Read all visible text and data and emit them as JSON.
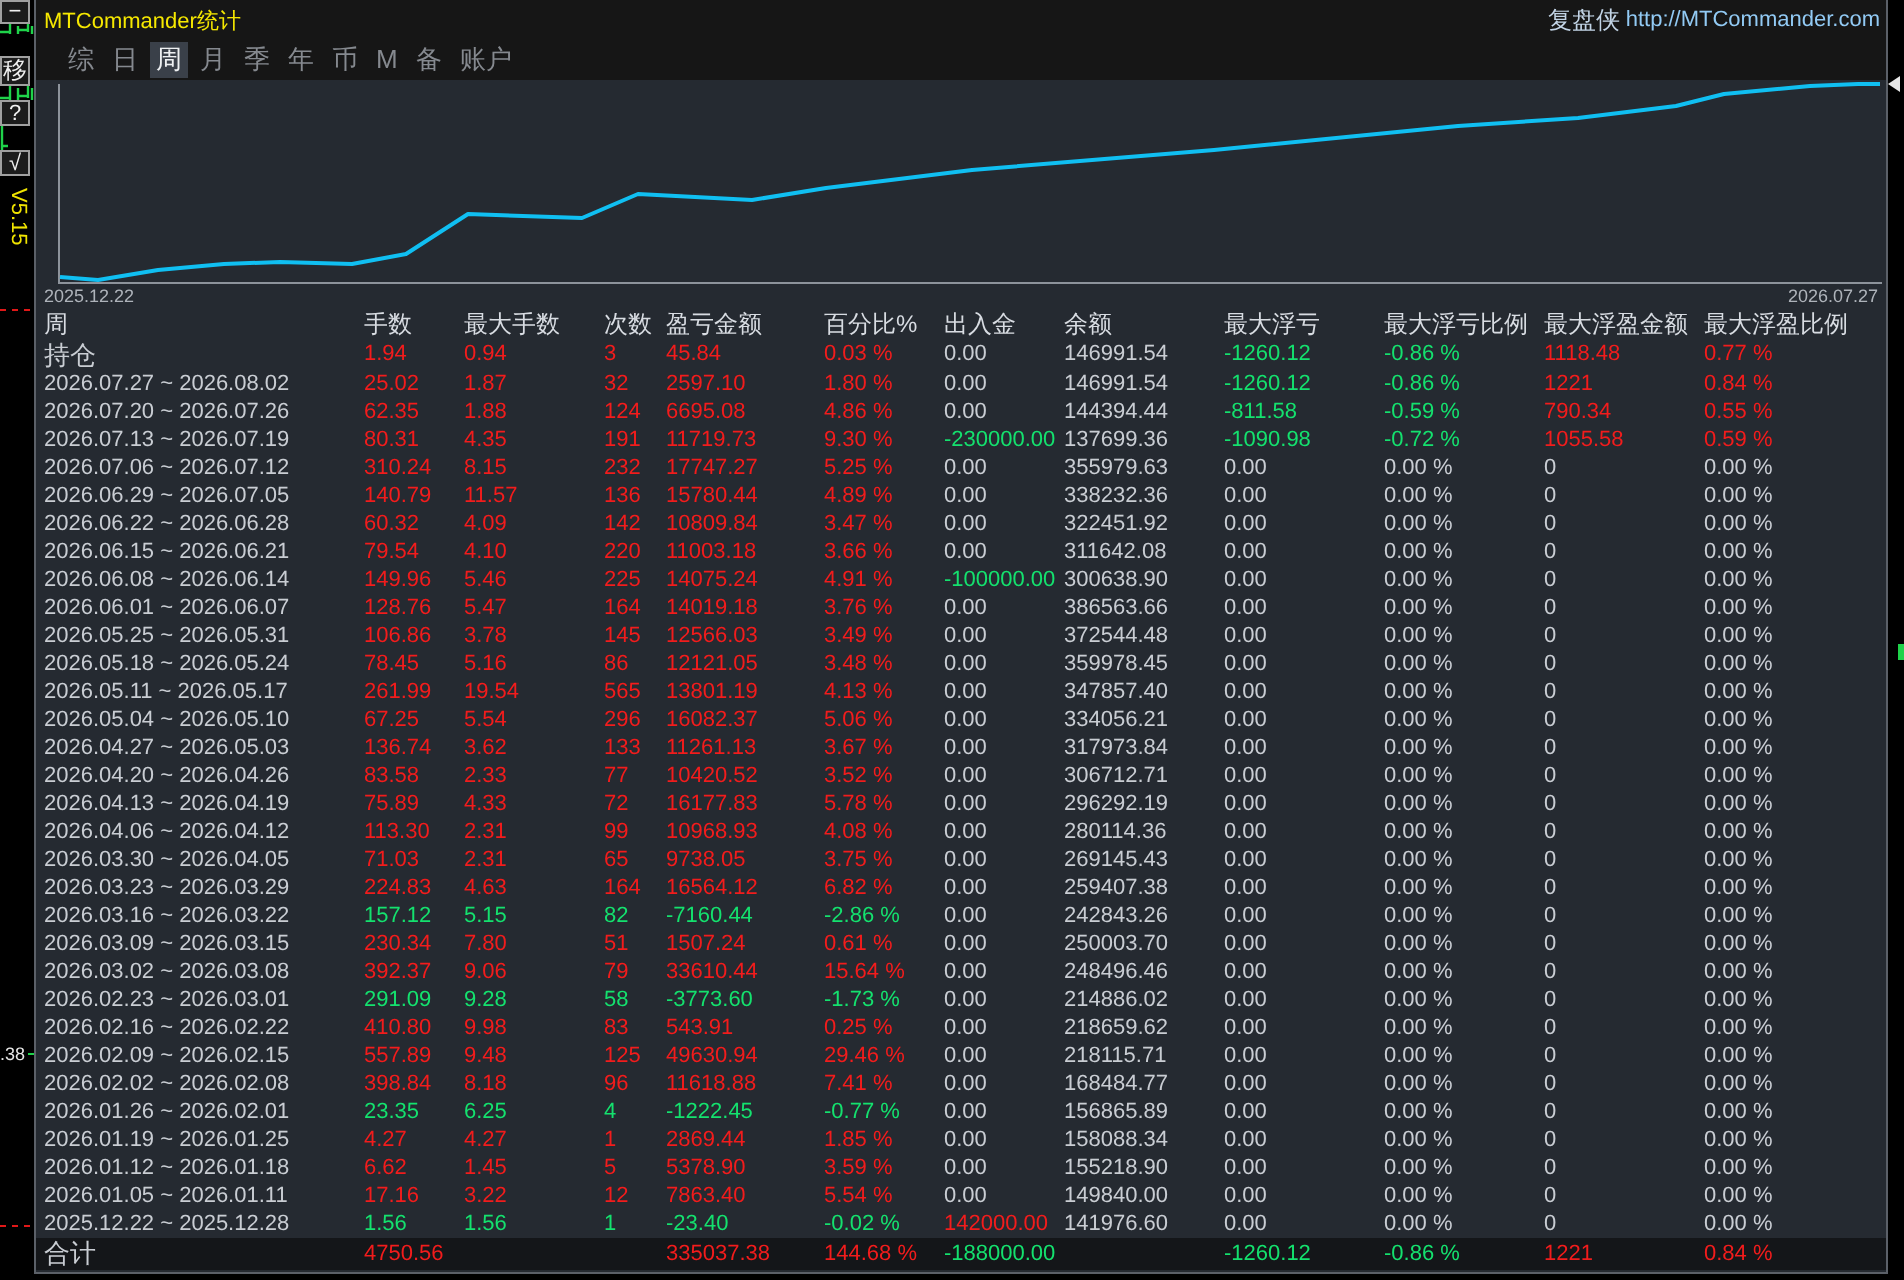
{
  "left_toolbar": {
    "buttons": [
      "−",
      "移",
      "?",
      "√"
    ],
    "version": "V5.15",
    "price_label": ".38"
  },
  "window": {
    "title": "MTCommander统计",
    "brand": "复盘侠",
    "url": "http://MTCommander.com"
  },
  "tabs": [
    {
      "label": "综",
      "selected": false
    },
    {
      "label": "日",
      "selected": false
    },
    {
      "label": "周",
      "selected": true
    },
    {
      "label": "月",
      "selected": false
    },
    {
      "label": "季",
      "selected": false
    },
    {
      "label": "年",
      "selected": false
    },
    {
      "label": "币",
      "selected": false
    },
    {
      "label": "M",
      "selected": false
    },
    {
      "label": "备",
      "selected": false
    },
    {
      "label": "账户",
      "selected": false
    }
  ],
  "chart": {
    "start_label": "2025.12.22",
    "end_label": "2026.07.27"
  },
  "table": {
    "columns": [
      "周",
      "手数",
      "最大手数",
      "次数",
      "盈亏金额",
      "百分比%",
      "出入金",
      "余额",
      "最大浮亏",
      "最大浮亏比例",
      "最大浮盈金额",
      "最大浮盈比例"
    ],
    "rows": [
      {
        "kind": "open",
        "cells": [
          {
            "text": "持仓"
          },
          {
            "text": "1.94",
            "color": "#f21c1c"
          },
          {
            "text": "0.94",
            "color": "#f21c1c"
          },
          {
            "text": "3",
            "color": "#f21c1c"
          },
          {
            "text": "45.84",
            "color": "#f21c1c"
          },
          {
            "text": "0.03 %",
            "color": "#f21c1c"
          },
          {
            "text": "0.00"
          },
          {
            "text": "146991.54"
          },
          {
            "text": "-1260.12",
            "color": "#14e16e"
          },
          {
            "text": "-0.86 %",
            "color": "#14e16e"
          },
          {
            "text": "1118.48",
            "color": "#f21c1c"
          },
          {
            "text": "0.77 %",
            "color": "#f21c1c"
          }
        ]
      },
      {
        "kind": "week",
        "cells": [
          {
            "text": "2026.07.27 ~ 2026.08.02"
          },
          {
            "text": "25.02",
            "color": "#f21c1c"
          },
          {
            "text": "1.87",
            "color": "#f21c1c"
          },
          {
            "text": "32",
            "color": "#f21c1c"
          },
          {
            "text": "2597.10",
            "color": "#f21c1c"
          },
          {
            "text": "1.80 %",
            "color": "#f21c1c"
          },
          {
            "text": "0.00"
          },
          {
            "text": "146991.54"
          },
          {
            "text": "-1260.12",
            "color": "#14e16e"
          },
          {
            "text": "-0.86 %",
            "color": "#14e16e"
          },
          {
            "text": "1221",
            "color": "#f21c1c"
          },
          {
            "text": "0.84 %",
            "color": "#f21c1c"
          }
        ]
      },
      {
        "kind": "week",
        "cells": [
          {
            "text": "2026.07.20 ~ 2026.07.26"
          },
          {
            "text": "62.35",
            "color": "#f21c1c"
          },
          {
            "text": "1.88",
            "color": "#f21c1c"
          },
          {
            "text": "124",
            "color": "#f21c1c"
          },
          {
            "text": "6695.08",
            "color": "#f21c1c"
          },
          {
            "text": "4.86 %",
            "color": "#f21c1c"
          },
          {
            "text": "0.00"
          },
          {
            "text": "144394.44"
          },
          {
            "text": "-811.58",
            "color": "#14e16e"
          },
          {
            "text": "-0.59 %",
            "color": "#14e16e"
          },
          {
            "text": "790.34",
            "color": "#f21c1c"
          },
          {
            "text": "0.55 %",
            "color": "#f21c1c"
          }
        ]
      },
      {
        "kind": "week",
        "cells": [
          {
            "text": "2026.07.13 ~ 2026.07.19"
          },
          {
            "text": "80.31",
            "color": "#f21c1c"
          },
          {
            "text": "4.35",
            "color": "#f21c1c"
          },
          {
            "text": "191",
            "color": "#f21c1c"
          },
          {
            "text": "11719.73",
            "color": "#f21c1c"
          },
          {
            "text": "9.30 %",
            "color": "#f21c1c"
          },
          {
            "text": "-230000.00",
            "color": "#14e16e"
          },
          {
            "text": "137699.36"
          },
          {
            "text": "-1090.98",
            "color": "#14e16e"
          },
          {
            "text": "-0.72 %",
            "color": "#14e16e"
          },
          {
            "text": "1055.58",
            "color": "#f21c1c"
          },
          {
            "text": "0.59 %",
            "color": "#f21c1c"
          }
        ]
      },
      {
        "kind": "week",
        "cells": [
          {
            "text": "2026.07.06 ~ 2026.07.12"
          },
          {
            "text": "310.24",
            "color": "#f21c1c"
          },
          {
            "text": "8.15",
            "color": "#f21c1c"
          },
          {
            "text": "232",
            "color": "#f21c1c"
          },
          {
            "text": "17747.27",
            "color": "#f21c1c"
          },
          {
            "text": "5.25 %",
            "color": "#f21c1c"
          },
          {
            "text": "0.00"
          },
          {
            "text": "355979.63"
          },
          {
            "text": "0.00"
          },
          {
            "text": "0.00 %"
          },
          {
            "text": "0"
          },
          {
            "text": "0.00 %"
          }
        ]
      },
      {
        "kind": "week",
        "cells": [
          {
            "text": "2026.06.29 ~ 2026.07.05"
          },
          {
            "text": "140.79",
            "color": "#f21c1c"
          },
          {
            "text": "11.57",
            "color": "#f21c1c"
          },
          {
            "text": "136",
            "color": "#f21c1c"
          },
          {
            "text": "15780.44",
            "color": "#f21c1c"
          },
          {
            "text": "4.89 %",
            "color": "#f21c1c"
          },
          {
            "text": "0.00"
          },
          {
            "text": "338232.36"
          },
          {
            "text": "0.00"
          },
          {
            "text": "0.00 %"
          },
          {
            "text": "0"
          },
          {
            "text": "0.00 %"
          }
        ]
      },
      {
        "kind": "week",
        "cells": [
          {
            "text": "2026.06.22 ~ 2026.06.28"
          },
          {
            "text": "60.32",
            "color": "#f21c1c"
          },
          {
            "text": "4.09",
            "color": "#f21c1c"
          },
          {
            "text": "142",
            "color": "#f21c1c"
          },
          {
            "text": "10809.84",
            "color": "#f21c1c"
          },
          {
            "text": "3.47 %",
            "color": "#f21c1c"
          },
          {
            "text": "0.00"
          },
          {
            "text": "322451.92"
          },
          {
            "text": "0.00"
          },
          {
            "text": "0.00 %"
          },
          {
            "text": "0"
          },
          {
            "text": "0.00 %"
          }
        ]
      },
      {
        "kind": "week",
        "cells": [
          {
            "text": "2026.06.15 ~ 2026.06.21"
          },
          {
            "text": "79.54",
            "color": "#f21c1c"
          },
          {
            "text": "4.10",
            "color": "#f21c1c"
          },
          {
            "text": "220",
            "color": "#f21c1c"
          },
          {
            "text": "11003.18",
            "color": "#f21c1c"
          },
          {
            "text": "3.66 %",
            "color": "#f21c1c"
          },
          {
            "text": "0.00"
          },
          {
            "text": "311642.08"
          },
          {
            "text": "0.00"
          },
          {
            "text": "0.00 %"
          },
          {
            "text": "0"
          },
          {
            "text": "0.00 %"
          }
        ]
      },
      {
        "kind": "week",
        "cells": [
          {
            "text": "2026.06.08 ~ 2026.06.14"
          },
          {
            "text": "149.96",
            "color": "#f21c1c"
          },
          {
            "text": "5.46",
            "color": "#f21c1c"
          },
          {
            "text": "225",
            "color": "#f21c1c"
          },
          {
            "text": "14075.24",
            "color": "#f21c1c"
          },
          {
            "text": "4.91 %",
            "color": "#f21c1c"
          },
          {
            "text": "-100000.00",
            "color": "#14e16e"
          },
          {
            "text": "300638.90"
          },
          {
            "text": "0.00"
          },
          {
            "text": "0.00 %"
          },
          {
            "text": "0"
          },
          {
            "text": "0.00 %"
          }
        ]
      },
      {
        "kind": "week",
        "cells": [
          {
            "text": "2026.06.01 ~ 2026.06.07"
          },
          {
            "text": "128.76",
            "color": "#f21c1c"
          },
          {
            "text": "5.47",
            "color": "#f21c1c"
          },
          {
            "text": "164",
            "color": "#f21c1c"
          },
          {
            "text": "14019.18",
            "color": "#f21c1c"
          },
          {
            "text": "3.76 %",
            "color": "#f21c1c"
          },
          {
            "text": "0.00"
          },
          {
            "text": "386563.66"
          },
          {
            "text": "0.00"
          },
          {
            "text": "0.00 %"
          },
          {
            "text": "0"
          },
          {
            "text": "0.00 %"
          }
        ]
      },
      {
        "kind": "week",
        "cells": [
          {
            "text": "2026.05.25 ~ 2026.05.31"
          },
          {
            "text": "106.86",
            "color": "#f21c1c"
          },
          {
            "text": "3.78",
            "color": "#f21c1c"
          },
          {
            "text": "145",
            "color": "#f21c1c"
          },
          {
            "text": "12566.03",
            "color": "#f21c1c"
          },
          {
            "text": "3.49 %",
            "color": "#f21c1c"
          },
          {
            "text": "0.00"
          },
          {
            "text": "372544.48"
          },
          {
            "text": "0.00"
          },
          {
            "text": "0.00 %"
          },
          {
            "text": "0"
          },
          {
            "text": "0.00 %"
          }
        ]
      },
      {
        "kind": "week",
        "cells": [
          {
            "text": "2026.05.18 ~ 2026.05.24"
          },
          {
            "text": "78.45",
            "color": "#f21c1c"
          },
          {
            "text": "5.16",
            "color": "#f21c1c"
          },
          {
            "text": "86",
            "color": "#f21c1c"
          },
          {
            "text": "12121.05",
            "color": "#f21c1c"
          },
          {
            "text": "3.48 %",
            "color": "#f21c1c"
          },
          {
            "text": "0.00"
          },
          {
            "text": "359978.45"
          },
          {
            "text": "0.00"
          },
          {
            "text": "0.00 %"
          },
          {
            "text": "0"
          },
          {
            "text": "0.00 %"
          }
        ]
      },
      {
        "kind": "week",
        "cells": [
          {
            "text": "2026.05.11 ~ 2026.05.17"
          },
          {
            "text": "261.99",
            "color": "#f21c1c"
          },
          {
            "text": "19.54",
            "color": "#f21c1c"
          },
          {
            "text": "565",
            "color": "#f21c1c"
          },
          {
            "text": "13801.19",
            "color": "#f21c1c"
          },
          {
            "text": "4.13 %",
            "color": "#f21c1c"
          },
          {
            "text": "0.00"
          },
          {
            "text": "347857.40"
          },
          {
            "text": "0.00"
          },
          {
            "text": "0.00 %"
          },
          {
            "text": "0"
          },
          {
            "text": "0.00 %"
          }
        ]
      },
      {
        "kind": "week",
        "cells": [
          {
            "text": "2026.05.04 ~ 2026.05.10"
          },
          {
            "text": "67.25",
            "color": "#f21c1c"
          },
          {
            "text": "5.54",
            "color": "#f21c1c"
          },
          {
            "text": "296",
            "color": "#f21c1c"
          },
          {
            "text": "16082.37",
            "color": "#f21c1c"
          },
          {
            "text": "5.06 %",
            "color": "#f21c1c"
          },
          {
            "text": "0.00"
          },
          {
            "text": "334056.21"
          },
          {
            "text": "0.00"
          },
          {
            "text": "0.00 %"
          },
          {
            "text": "0"
          },
          {
            "text": "0.00 %"
          }
        ]
      },
      {
        "kind": "week",
        "cells": [
          {
            "text": "2026.04.27 ~ 2026.05.03"
          },
          {
            "text": "136.74",
            "color": "#f21c1c"
          },
          {
            "text": "3.62",
            "color": "#f21c1c"
          },
          {
            "text": "133",
            "color": "#f21c1c"
          },
          {
            "text": "11261.13",
            "color": "#f21c1c"
          },
          {
            "text": "3.67 %",
            "color": "#f21c1c"
          },
          {
            "text": "0.00"
          },
          {
            "text": "317973.84"
          },
          {
            "text": "0.00"
          },
          {
            "text": "0.00 %"
          },
          {
            "text": "0"
          },
          {
            "text": "0.00 %"
          }
        ]
      },
      {
        "kind": "week",
        "cells": [
          {
            "text": "2026.04.20 ~ 2026.04.26"
          },
          {
            "text": "83.58",
            "color": "#f21c1c"
          },
          {
            "text": "2.33",
            "color": "#f21c1c"
          },
          {
            "text": "77",
            "color": "#f21c1c"
          },
          {
            "text": "10420.52",
            "color": "#f21c1c"
          },
          {
            "text": "3.52 %",
            "color": "#f21c1c"
          },
          {
            "text": "0.00"
          },
          {
            "text": "306712.71"
          },
          {
            "text": "0.00"
          },
          {
            "text": "0.00 %"
          },
          {
            "text": "0"
          },
          {
            "text": "0.00 %"
          }
        ]
      },
      {
        "kind": "week",
        "cells": [
          {
            "text": "2026.04.13 ~ 2026.04.19"
          },
          {
            "text": "75.89",
            "color": "#f21c1c"
          },
          {
            "text": "4.33",
            "color": "#f21c1c"
          },
          {
            "text": "72",
            "color": "#f21c1c"
          },
          {
            "text": "16177.83",
            "color": "#f21c1c"
          },
          {
            "text": "5.78 %",
            "color": "#f21c1c"
          },
          {
            "text": "0.00"
          },
          {
            "text": "296292.19"
          },
          {
            "text": "0.00"
          },
          {
            "text": "0.00 %"
          },
          {
            "text": "0"
          },
          {
            "text": "0.00 %"
          }
        ]
      },
      {
        "kind": "week",
        "cells": [
          {
            "text": "2026.04.06 ~ 2026.04.12"
          },
          {
            "text": "113.30",
            "color": "#f21c1c"
          },
          {
            "text": "2.31",
            "color": "#f21c1c"
          },
          {
            "text": "99",
            "color": "#f21c1c"
          },
          {
            "text": "10968.93",
            "color": "#f21c1c"
          },
          {
            "text": "4.08 %",
            "color": "#f21c1c"
          },
          {
            "text": "0.00"
          },
          {
            "text": "280114.36"
          },
          {
            "text": "0.00"
          },
          {
            "text": "0.00 %"
          },
          {
            "text": "0"
          },
          {
            "text": "0.00 %"
          }
        ]
      },
      {
        "kind": "week",
        "cells": [
          {
            "text": "2026.03.30 ~ 2026.04.05"
          },
          {
            "text": "71.03",
            "color": "#f21c1c"
          },
          {
            "text": "2.31",
            "color": "#f21c1c"
          },
          {
            "text": "65",
            "color": "#f21c1c"
          },
          {
            "text": "9738.05",
            "color": "#f21c1c"
          },
          {
            "text": "3.75 %",
            "color": "#f21c1c"
          },
          {
            "text": "0.00"
          },
          {
            "text": "269145.43"
          },
          {
            "text": "0.00"
          },
          {
            "text": "0.00 %"
          },
          {
            "text": "0"
          },
          {
            "text": "0.00 %"
          }
        ]
      },
      {
        "kind": "week",
        "cells": [
          {
            "text": "2026.03.23 ~ 2026.03.29"
          },
          {
            "text": "224.83",
            "color": "#f21c1c"
          },
          {
            "text": "4.63",
            "color": "#f21c1c"
          },
          {
            "text": "164",
            "color": "#f21c1c"
          },
          {
            "text": "16564.12",
            "color": "#f21c1c"
          },
          {
            "text": "6.82 %",
            "color": "#f21c1c"
          },
          {
            "text": "0.00"
          },
          {
            "text": "259407.38"
          },
          {
            "text": "0.00"
          },
          {
            "text": "0.00 %"
          },
          {
            "text": "0"
          },
          {
            "text": "0.00 %"
          }
        ]
      },
      {
        "kind": "week",
        "cells": [
          {
            "text": "2026.03.16 ~ 2026.03.22"
          },
          {
            "text": "157.12",
            "color": "#14e16e"
          },
          {
            "text": "5.15",
            "color": "#14e16e"
          },
          {
            "text": "82",
            "color": "#14e16e"
          },
          {
            "text": "-7160.44",
            "color": "#14e16e"
          },
          {
            "text": "-2.86 %",
            "color": "#14e16e"
          },
          {
            "text": "0.00"
          },
          {
            "text": "242843.26"
          },
          {
            "text": "0.00"
          },
          {
            "text": "0.00 %"
          },
          {
            "text": "0"
          },
          {
            "text": "0.00 %"
          }
        ]
      },
      {
        "kind": "week",
        "cells": [
          {
            "text": "2026.03.09 ~ 2026.03.15"
          },
          {
            "text": "230.34",
            "color": "#f21c1c"
          },
          {
            "text": "7.80",
            "color": "#f21c1c"
          },
          {
            "text": "51",
            "color": "#f21c1c"
          },
          {
            "text": "1507.24",
            "color": "#f21c1c"
          },
          {
            "text": "0.61 %",
            "color": "#f21c1c"
          },
          {
            "text": "0.00"
          },
          {
            "text": "250003.70"
          },
          {
            "text": "0.00"
          },
          {
            "text": "0.00 %"
          },
          {
            "text": "0"
          },
          {
            "text": "0.00 %"
          }
        ]
      },
      {
        "kind": "week",
        "cells": [
          {
            "text": "2026.03.02 ~ 2026.03.08"
          },
          {
            "text": "392.37",
            "color": "#f21c1c"
          },
          {
            "text": "9.06",
            "color": "#f21c1c"
          },
          {
            "text": "79",
            "color": "#f21c1c"
          },
          {
            "text": "33610.44",
            "color": "#f21c1c"
          },
          {
            "text": "15.64 %",
            "color": "#f21c1c"
          },
          {
            "text": "0.00"
          },
          {
            "text": "248496.46"
          },
          {
            "text": "0.00"
          },
          {
            "text": "0.00 %"
          },
          {
            "text": "0"
          },
          {
            "text": "0.00 %"
          }
        ]
      },
      {
        "kind": "week",
        "cells": [
          {
            "text": "2026.02.23 ~ 2026.03.01"
          },
          {
            "text": "291.09",
            "color": "#14e16e"
          },
          {
            "text": "9.28",
            "color": "#14e16e"
          },
          {
            "text": "58",
            "color": "#14e16e"
          },
          {
            "text": "-3773.60",
            "color": "#14e16e"
          },
          {
            "text": "-1.73 %",
            "color": "#14e16e"
          },
          {
            "text": "0.00"
          },
          {
            "text": "214886.02"
          },
          {
            "text": "0.00"
          },
          {
            "text": "0.00 %"
          },
          {
            "text": "0"
          },
          {
            "text": "0.00 %"
          }
        ]
      },
      {
        "kind": "week",
        "cells": [
          {
            "text": "2026.02.16 ~ 2026.02.22"
          },
          {
            "text": "410.80",
            "color": "#f21c1c"
          },
          {
            "text": "9.98",
            "color": "#f21c1c"
          },
          {
            "text": "83",
            "color": "#f21c1c"
          },
          {
            "text": "543.91",
            "color": "#f21c1c"
          },
          {
            "text": "0.25 %",
            "color": "#f21c1c"
          },
          {
            "text": "0.00"
          },
          {
            "text": "218659.62"
          },
          {
            "text": "0.00"
          },
          {
            "text": "0.00 %"
          },
          {
            "text": "0"
          },
          {
            "text": "0.00 %"
          }
        ]
      },
      {
        "kind": "week",
        "cells": [
          {
            "text": "2026.02.09 ~ 2026.02.15"
          },
          {
            "text": "557.89",
            "color": "#f21c1c"
          },
          {
            "text": "9.48",
            "color": "#f21c1c"
          },
          {
            "text": "125",
            "color": "#f21c1c"
          },
          {
            "text": "49630.94",
            "color": "#f21c1c"
          },
          {
            "text": "29.46 %",
            "color": "#f21c1c"
          },
          {
            "text": "0.00"
          },
          {
            "text": "218115.71"
          },
          {
            "text": "0.00"
          },
          {
            "text": "0.00 %"
          },
          {
            "text": "0"
          },
          {
            "text": "0.00 %"
          }
        ]
      },
      {
        "kind": "week",
        "cells": [
          {
            "text": "2026.02.02 ~ 2026.02.08"
          },
          {
            "text": "398.84",
            "color": "#f21c1c"
          },
          {
            "text": "8.18",
            "color": "#f21c1c"
          },
          {
            "text": "96",
            "color": "#f21c1c"
          },
          {
            "text": "11618.88",
            "color": "#f21c1c"
          },
          {
            "text": "7.41 %",
            "color": "#f21c1c"
          },
          {
            "text": "0.00"
          },
          {
            "text": "168484.77"
          },
          {
            "text": "0.00"
          },
          {
            "text": "0.00 %"
          },
          {
            "text": "0"
          },
          {
            "text": "0.00 %"
          }
        ]
      },
      {
        "kind": "week",
        "cells": [
          {
            "text": "2026.01.26 ~ 2026.02.01"
          },
          {
            "text": "23.35",
            "color": "#14e16e"
          },
          {
            "text": "6.25",
            "color": "#14e16e"
          },
          {
            "text": "4",
            "color": "#14e16e"
          },
          {
            "text": "-1222.45",
            "color": "#14e16e"
          },
          {
            "text": "-0.77 %",
            "color": "#14e16e"
          },
          {
            "text": "0.00"
          },
          {
            "text": "156865.89"
          },
          {
            "text": "0.00"
          },
          {
            "text": "0.00 %"
          },
          {
            "text": "0"
          },
          {
            "text": "0.00 %"
          }
        ]
      },
      {
        "kind": "week",
        "cells": [
          {
            "text": "2026.01.19 ~ 2026.01.25"
          },
          {
            "text": "4.27",
            "color": "#f21c1c"
          },
          {
            "text": "4.27",
            "color": "#f21c1c"
          },
          {
            "text": "1",
            "color": "#f21c1c"
          },
          {
            "text": "2869.44",
            "color": "#f21c1c"
          },
          {
            "text": "1.85 %",
            "color": "#f21c1c"
          },
          {
            "text": "0.00"
          },
          {
            "text": "158088.34"
          },
          {
            "text": "0.00"
          },
          {
            "text": "0.00 %"
          },
          {
            "text": "0"
          },
          {
            "text": "0.00 %"
          }
        ]
      },
      {
        "kind": "week",
        "cells": [
          {
            "text": "2026.01.12 ~ 2026.01.18"
          },
          {
            "text": "6.62",
            "color": "#f21c1c"
          },
          {
            "text": "1.45",
            "color": "#f21c1c"
          },
          {
            "text": "5",
            "color": "#f21c1c"
          },
          {
            "text": "5378.90",
            "color": "#f21c1c"
          },
          {
            "text": "3.59 %",
            "color": "#f21c1c"
          },
          {
            "text": "0.00"
          },
          {
            "text": "155218.90"
          },
          {
            "text": "0.00"
          },
          {
            "text": "0.00 %"
          },
          {
            "text": "0"
          },
          {
            "text": "0.00 %"
          }
        ]
      },
      {
        "kind": "week",
        "cells": [
          {
            "text": "2026.01.05 ~ 2026.01.11"
          },
          {
            "text": "17.16",
            "color": "#f21c1c"
          },
          {
            "text": "3.22",
            "color": "#f21c1c"
          },
          {
            "text": "12",
            "color": "#f21c1c"
          },
          {
            "text": "7863.40",
            "color": "#f21c1c"
          },
          {
            "text": "5.54 %",
            "color": "#f21c1c"
          },
          {
            "text": "0.00"
          },
          {
            "text": "149840.00"
          },
          {
            "text": "0.00"
          },
          {
            "text": "0.00 %"
          },
          {
            "text": "0"
          },
          {
            "text": "0.00 %"
          }
        ]
      },
      {
        "kind": "week",
        "cells": [
          {
            "text": "2025.12.22 ~ 2025.12.28"
          },
          {
            "text": "1.56",
            "color": "#14e16e"
          },
          {
            "text": "1.56",
            "color": "#14e16e"
          },
          {
            "text": "1",
            "color": "#14e16e"
          },
          {
            "text": "-23.40",
            "color": "#14e16e"
          },
          {
            "text": "-0.02 %",
            "color": "#14e16e"
          },
          {
            "text": "142000.00",
            "color": "#f21c1c"
          },
          {
            "text": "141976.60"
          },
          {
            "text": "0.00"
          },
          {
            "text": "0.00 %"
          },
          {
            "text": "0"
          },
          {
            "text": "0.00 %"
          }
        ]
      },
      {
        "kind": "total",
        "cells": [
          {
            "text": "合计"
          },
          {
            "text": "4750.56",
            "color": "#f21c1c"
          },
          null,
          null,
          {
            "text": "335037.38",
            "color": "#f21c1c"
          },
          {
            "text": "144.68 %",
            "color": "#f21c1c"
          },
          {
            "text": "-188000.00",
            "color": "#14e16e"
          },
          null,
          {
            "text": "-1260.12",
            "color": "#14e16e"
          },
          {
            "text": "-0.86 %",
            "color": "#14e16e"
          },
          {
            "text": "1221",
            "color": "#f21c1c"
          },
          {
            "text": "0.84 %",
            "color": "#f21c1c"
          }
        ]
      }
    ]
  }
}
